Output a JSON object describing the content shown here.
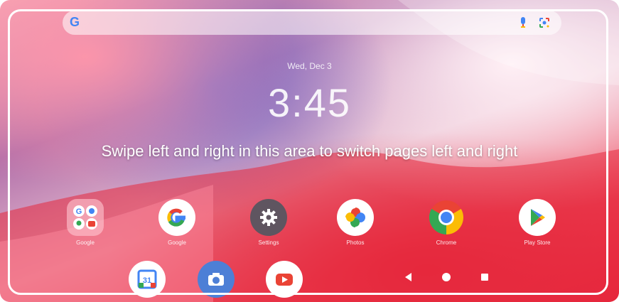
{
  "search": {
    "logo": "G"
  },
  "lock": {
    "date": "Wed, Dec 3",
    "time": "3:45"
  },
  "caption": "Swipe left and right in this area to switch pages left and right",
  "apps": [
    {
      "label": "Google",
      "icon": "google-folder-icon"
    },
    {
      "label": "Google",
      "icon": "google-icon"
    },
    {
      "label": "Settings",
      "icon": "gear-icon"
    },
    {
      "label": "Photos",
      "icon": "photos-icon"
    },
    {
      "label": "Chrome",
      "icon": "chrome-icon"
    },
    {
      "label": "Play Store",
      "icon": "play-store-icon"
    }
  ],
  "dock": [
    {
      "label": "31",
      "icon": "calendar-icon"
    },
    {
      "icon": "camera-icon"
    },
    {
      "icon": "youtube-icon"
    }
  ],
  "colors": {
    "google_blue": "#4285F4",
    "google_red": "#EA4335",
    "google_yellow": "#FBBC05",
    "google_green": "#34A853"
  }
}
